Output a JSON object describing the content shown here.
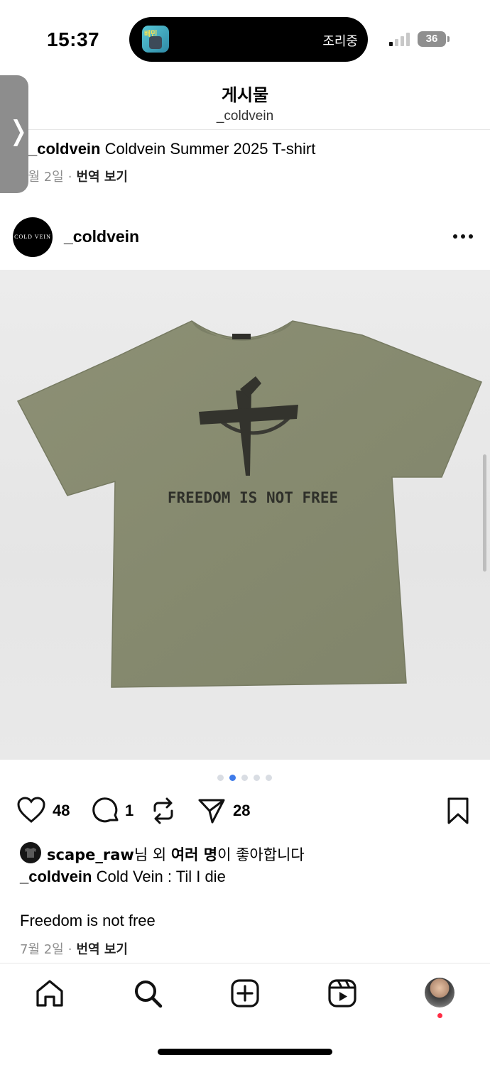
{
  "status_bar": {
    "time": "15:37",
    "live_activity_text": "조리중",
    "app_badge_text": "배민",
    "battery": "36"
  },
  "header": {
    "title": "게시물",
    "subtitle": "_coldvein"
  },
  "previous_post": {
    "caption_user": "_coldvein",
    "caption_text": " Coldvein Summer 2025 T-shirt",
    "date": "7월 2일",
    "translate": "번역 보기"
  },
  "post": {
    "username": "_coldvein",
    "avatar_text": "COLD VEIN",
    "image": {
      "alt_icon": "olive-tshirt-photo",
      "print_text": "FREEDOM IS NOT FREE",
      "shirt_color": "#8a8d72",
      "background_color": "#e8e8e8"
    },
    "pager": {
      "count": 5,
      "active": 2
    },
    "actions": {
      "likes": "48",
      "comments": "1",
      "shares": "28"
    },
    "liked_by": {
      "user": "scape_raw",
      "suffix_1": "님 외 ",
      "bold_others": "여러 명",
      "suffix_2": "이 좋아합니다"
    },
    "caption_user": "_coldvein",
    "caption_text": " Cold Vein : Til I die",
    "caption_line2": "Freedom is not free",
    "date": "7월 2일",
    "translate": "번역 보기"
  },
  "colors": {
    "accent": "#3f7be9",
    "notification": "#ff2d45"
  },
  "bottom_nav": {
    "items": [
      "home-icon",
      "search-icon",
      "create-icon",
      "reels-icon",
      "profile-avatar"
    ]
  }
}
